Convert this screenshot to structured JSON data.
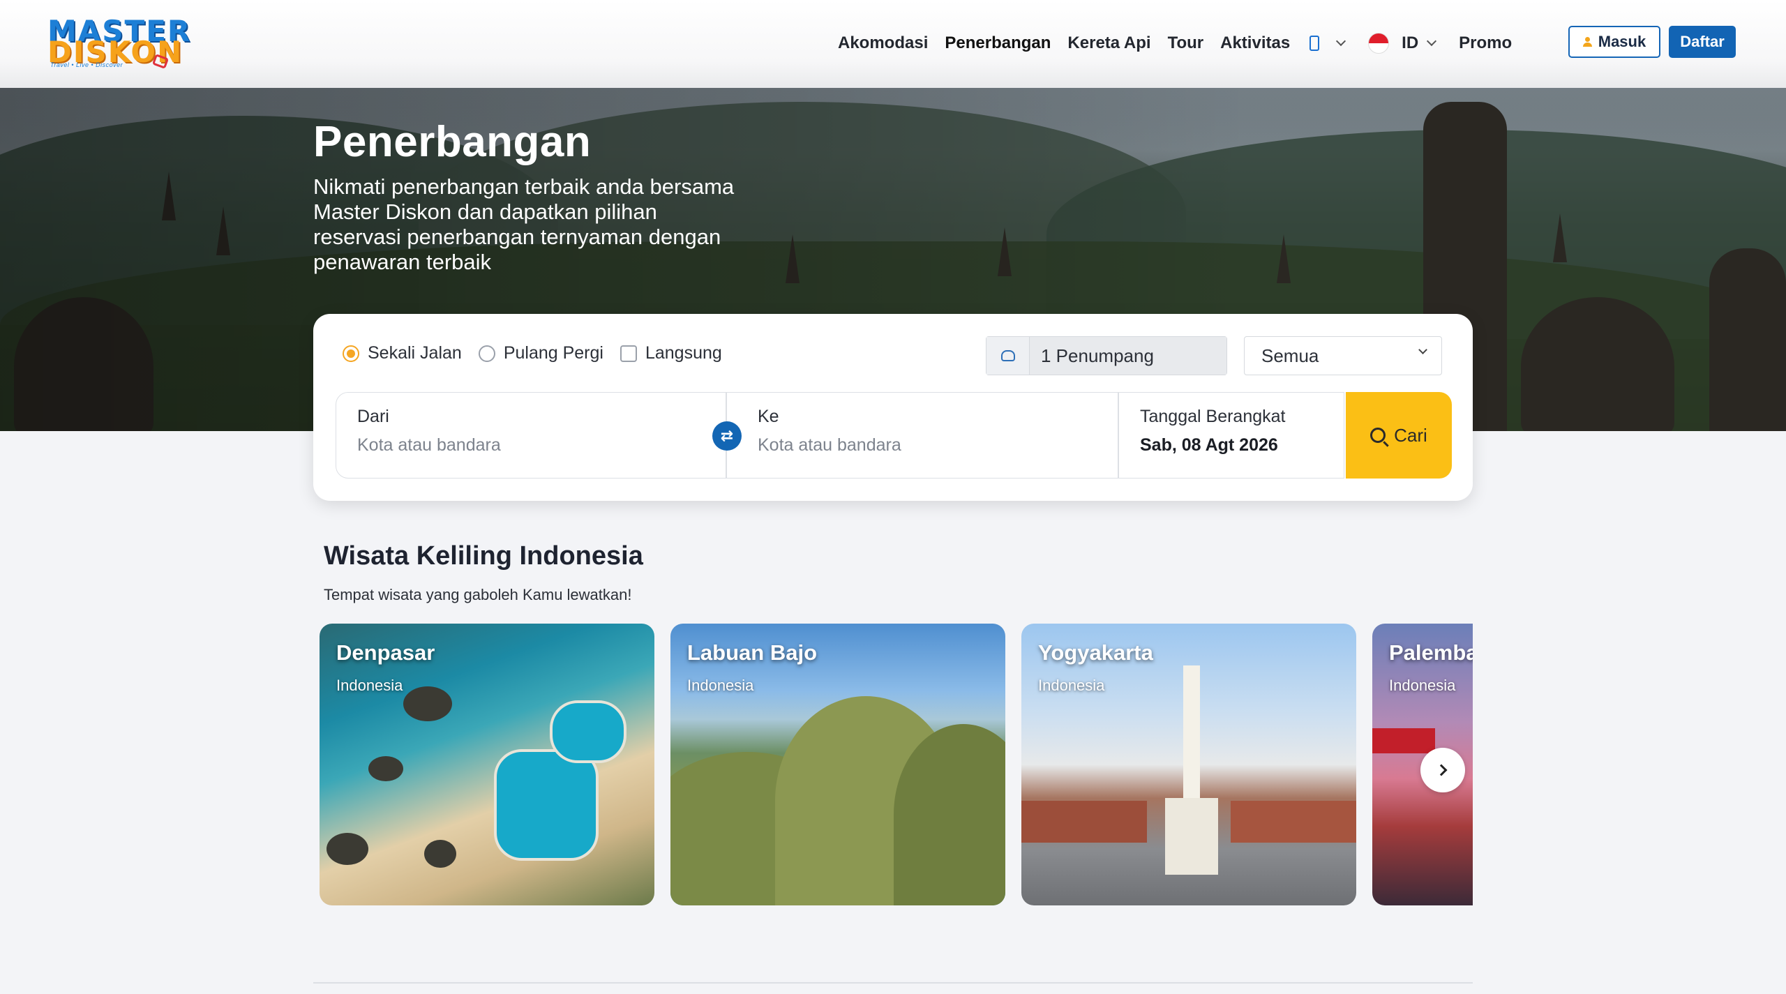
{
  "brand": {
    "name_line1": "MASTER",
    "name_line2": "DISKON",
    "tagline": "Travel • Live • Discover"
  },
  "nav": {
    "items": [
      "Akomodasi",
      "Penerbangan",
      "Kereta Api",
      "Tour",
      "Aktivitas"
    ],
    "active": "Penerbangan",
    "language": "ID",
    "promo": "Promo",
    "login": "Masuk",
    "register": "Daftar"
  },
  "hero": {
    "title": "Penerbangan",
    "subtitle": "Nikmati penerbangan terbaik anda bersama Master Diskon dan dapatkan pilihan reservasi penerbangan ternyaman dengan penawaran terbaik"
  },
  "search": {
    "trip_types": [
      "Sekali Jalan",
      "Pulang Pergi"
    ],
    "selected_trip_type": "Sekali Jalan",
    "direct_label": "Langsung",
    "direct_checked": false,
    "passengers": "1 Penumpang",
    "cabin_class": "Semua",
    "from_label": "Dari",
    "from_placeholder": "Kota atau bandara",
    "to_label": "Ke",
    "to_placeholder": "Kota atau bandara",
    "date_label": "Tanggal Berangkat",
    "date_value": "Sab, 08 Agt 2026",
    "search_button": "Cari"
  },
  "section": {
    "title": "Wisata Keliling Indonesia",
    "subtitle": "Tempat wisata yang gaboleh Kamu lewatkan!",
    "destinations": [
      {
        "name": "Denpasar",
        "country": "Indonesia"
      },
      {
        "name": "Labuan Bajo",
        "country": "Indonesia"
      },
      {
        "name": "Yogyakarta",
        "country": "Indonesia"
      },
      {
        "name": "Palembang",
        "country": "Indonesia"
      }
    ]
  },
  "colors": {
    "primary": "#1264b4",
    "accent": "#fbbf15",
    "radio_active": "#f5a623"
  },
  "icons": [
    "phone-icon",
    "chevron-down-icon",
    "flag-icon",
    "user-icon",
    "passenger-icon",
    "swap-icon",
    "search-icon",
    "chevron-right-icon"
  ]
}
